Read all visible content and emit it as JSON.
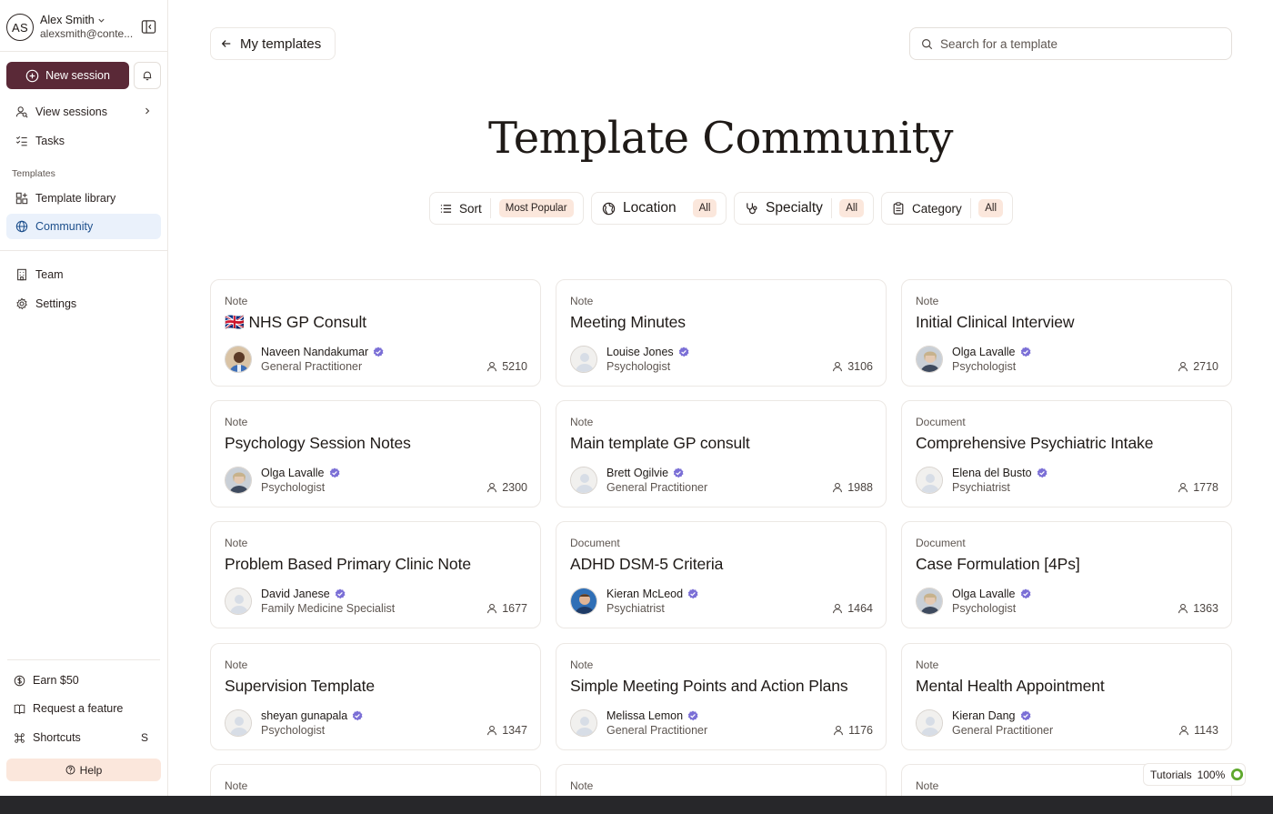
{
  "user": {
    "initials": "AS",
    "name": "Alex Smith",
    "email": "alexsmith@conte..."
  },
  "sidebar": {
    "new_session": "New session",
    "nav": [
      {
        "label": "View sessions"
      },
      {
        "label": "Tasks"
      }
    ],
    "templates_section": "Templates",
    "templates_nav": [
      {
        "label": "Template library"
      },
      {
        "label": "Community"
      }
    ],
    "bottom_nav": [
      {
        "label": "Team"
      },
      {
        "label": "Settings"
      }
    ],
    "footer": {
      "earn": "Earn $50",
      "request": "Request a feature",
      "shortcuts": "Shortcuts",
      "shortcuts_key": "S",
      "help": "Help"
    }
  },
  "header": {
    "back_label": "My templates",
    "search_placeholder": "Search for a template"
  },
  "page_title": "Template Community",
  "filters": {
    "sort": {
      "label": "Sort",
      "value": "Most Popular"
    },
    "location": {
      "label": "Location",
      "value": "All"
    },
    "specialty": {
      "label": "Specialty",
      "value": "All"
    },
    "category": {
      "label": "Category",
      "value": "All"
    }
  },
  "cards": [
    {
      "type": "Note",
      "title": "🇬🇧 NHS GP Consult",
      "author": "Naveen Nandakumar",
      "role": "General Practitioner",
      "uses": "5210",
      "avatar": "photo-dark"
    },
    {
      "type": "Note",
      "title": "Meeting Minutes",
      "author": "Louise Jones",
      "role": "Psychologist",
      "uses": "3106",
      "avatar": "placeholder"
    },
    {
      "type": "Note",
      "title": "Initial Clinical Interview",
      "author": "Olga Lavalle",
      "role": "Psychologist",
      "uses": "2710",
      "avatar": "photo-light"
    },
    {
      "type": "Note",
      "title": "Psychology Session Notes",
      "author": "Olga Lavalle",
      "role": "Psychologist",
      "uses": "2300",
      "avatar": "photo-light"
    },
    {
      "type": "Note",
      "title": "Main template GP consult",
      "author": "Brett Ogilvie",
      "role": "General Practitioner",
      "uses": "1988",
      "avatar": "placeholder"
    },
    {
      "type": "Document",
      "title": "Comprehensive Psychiatric Intake",
      "author": "Elena del Busto",
      "role": "Psychiatrist",
      "uses": "1778",
      "avatar": "placeholder"
    },
    {
      "type": "Note",
      "title": "Problem Based Primary Clinic Note",
      "author": "David Janese",
      "role": "Family Medicine Specialist",
      "uses": "1677",
      "avatar": "placeholder"
    },
    {
      "type": "Document",
      "title": "ADHD DSM-5 Criteria",
      "author": "Kieran McLeod",
      "role": "Psychiatrist",
      "uses": "1464",
      "avatar": "photo-blue"
    },
    {
      "type": "Document",
      "title": "Case Formulation [4Ps]",
      "author": "Olga Lavalle",
      "role": "Psychologist",
      "uses": "1363",
      "avatar": "photo-light"
    },
    {
      "type": "Note",
      "title": "Supervision Template",
      "author": "sheyan gunapala",
      "role": "Psychologist",
      "uses": "1347",
      "avatar": "placeholder"
    },
    {
      "type": "Note",
      "title": "Simple Meeting Points and Action Plans",
      "author": "Melissa Lemon",
      "role": "General Practitioner",
      "uses": "1176",
      "avatar": "placeholder"
    },
    {
      "type": "Note",
      "title": "Mental Health Appointment",
      "author": "Kieran Dang",
      "role": "General Practitioner",
      "uses": "1143",
      "avatar": "placeholder"
    }
  ],
  "partial_cards": [
    {
      "type": "Note"
    },
    {
      "type": "Note"
    },
    {
      "type": "Note"
    }
  ],
  "tutorials": {
    "label": "Tutorials",
    "percent": "100%"
  },
  "colors": {
    "primary": "#5a2937",
    "accent_pill": "#fbe7dc",
    "active_nav_bg": "#eaf1fb",
    "verified": "#7b6fd6",
    "progress": "#5fa82d"
  }
}
